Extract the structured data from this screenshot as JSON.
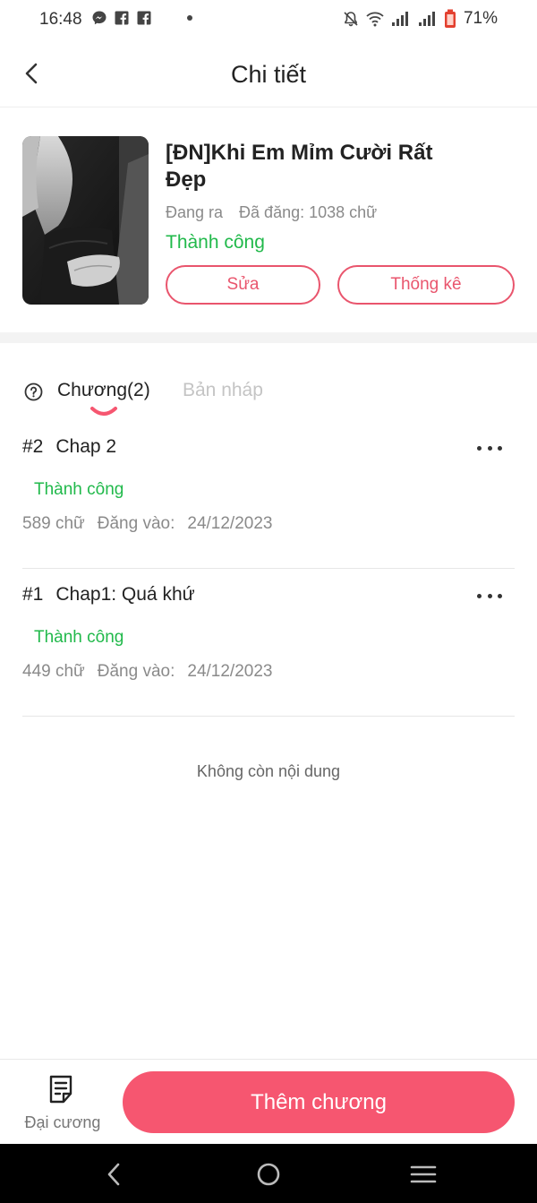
{
  "status_bar": {
    "time": "16:48",
    "battery": "71%",
    "icons": [
      "messenger-icon",
      "facebook-icon",
      "facebook-icon",
      "notification-dot",
      "mute-icon",
      "wifi-icon",
      "signal-icon",
      "signal-icon",
      "battery-icon"
    ]
  },
  "header": {
    "title": "Chi tiết"
  },
  "book": {
    "title": "[ĐN]Khi Em Mỉm Cười Rất Đẹp",
    "state": "Đang ra",
    "posted_words": "Đã đăng: 1038 chữ",
    "status": "Thành công",
    "edit_label": "Sửa",
    "stats_label": "Thống kê"
  },
  "tabs": {
    "chapters_label": "Chương(2)",
    "drafts_label": "Bản nháp"
  },
  "chapters": [
    {
      "number": "#2",
      "title": "Chap 2",
      "status": "Thành công",
      "words": "589 chữ",
      "posted_label": "Đăng vào:",
      "date": "24/12/2023"
    },
    {
      "number": "#1",
      "title": "Chap1: Quá khứ",
      "status": "Thành công",
      "words": "449 chữ",
      "posted_label": "Đăng vào:",
      "date": "24/12/2023"
    }
  ],
  "list_end_text": "Không còn nội dung",
  "bottom": {
    "outline_label": "Đại cương",
    "add_chapter_label": "Thêm chương"
  },
  "colors": {
    "accent": "#f65670",
    "success": "#21b94b",
    "muted": "#8a8a8a"
  }
}
